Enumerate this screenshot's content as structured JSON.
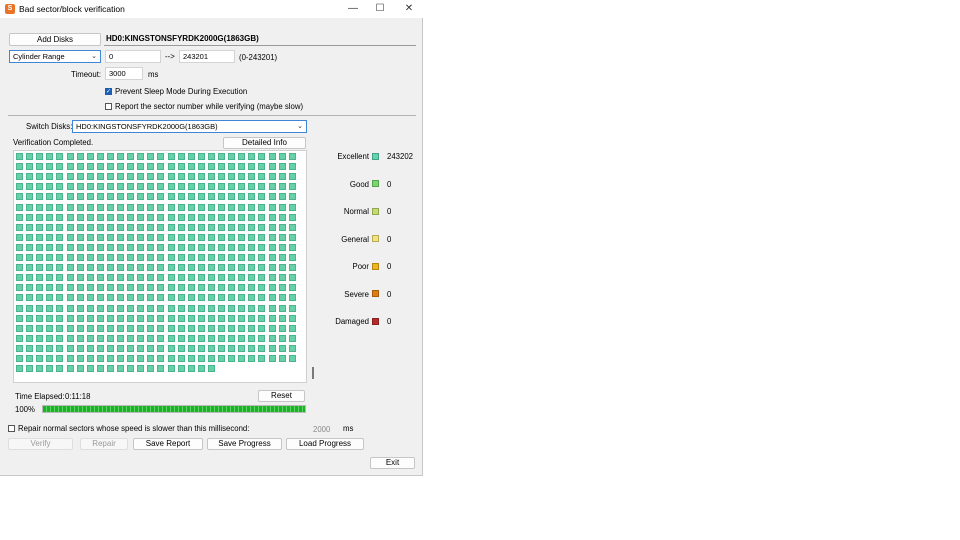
{
  "window": {
    "title": "Bad sector/block verification",
    "icon_letter": "S"
  },
  "titlebar": {
    "minimize": "—",
    "maximize": "☐",
    "close": "✕"
  },
  "top": {
    "add_disks_label": "Add Disks",
    "disk_name": "HD0:KINGSTONSFYRDK2000G(1863GB)",
    "range_mode": "Cylinder Range",
    "range_start": "0",
    "range_arrow": "-->",
    "range_end": "243201",
    "range_hint": "(0-243201)",
    "timeout_label": "Timeout:",
    "timeout_value": "3000",
    "timeout_unit": "ms",
    "prevent_sleep_label": "Prevent Sleep Mode During Execution",
    "prevent_sleep_checked": true,
    "report_sector_label": "Report the sector number while verifying (maybe slow)",
    "report_sector_checked": false
  },
  "switch": {
    "label": "Switch Disks:",
    "value": "HD0:KINGSTONSFYRDK2000G(1863GB)"
  },
  "status": {
    "text": "Verification Completed.",
    "detailed_info_label": "Detailed Info"
  },
  "grid": {
    "columns": 28,
    "full_rows": 21,
    "last_row_cells": 20,
    "cell_color": "#66d1a8"
  },
  "legend": [
    {
      "label": "Excellent",
      "value": "243202",
      "color": "#5ed6b0"
    },
    {
      "label": "Good",
      "value": "0",
      "color": "#76d96e"
    },
    {
      "label": "Normal",
      "value": "0",
      "color": "#c2dc6e"
    },
    {
      "label": "General",
      "value": "0",
      "color": "#f3e47a"
    },
    {
      "label": "Poor",
      "value": "0",
      "color": "#f1b51c"
    },
    {
      "label": "Severe",
      "value": "0",
      "color": "#e07a12"
    },
    {
      "label": "Damaged",
      "value": "0",
      "color": "#b52b2b"
    }
  ],
  "elapsed": {
    "label": "Time Elapsed:",
    "value": "0:11:18",
    "reset_label": "Reset",
    "percent_text": "100%",
    "progress": 1.0
  },
  "repair": {
    "label": "Repair normal sectors whose speed is slower than this millisecond:",
    "checked": false,
    "value": "2000",
    "unit": "ms"
  },
  "actions": {
    "verify": "Verify",
    "repair": "Repair",
    "save_report": "Save Report",
    "save_progress": "Save Progress",
    "load_progress": "Load Progress",
    "exit": "Exit"
  }
}
